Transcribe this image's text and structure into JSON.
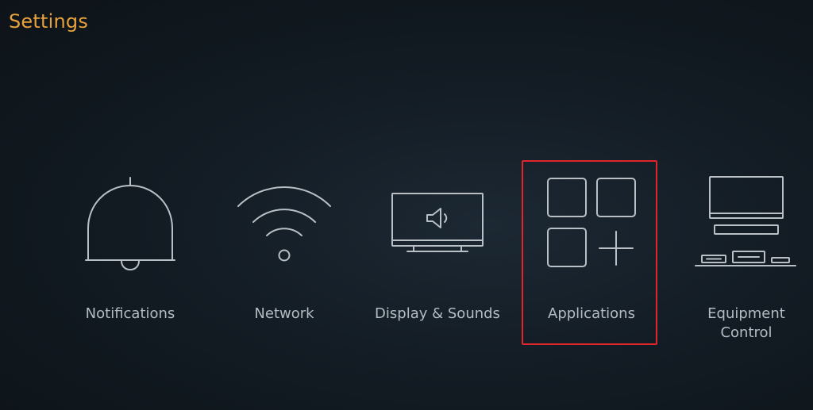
{
  "header": {
    "title": "Settings"
  },
  "menu": {
    "items": [
      {
        "id": "notifications",
        "label": "Notifications",
        "icon": "bell-icon"
      },
      {
        "id": "network",
        "label": "Network",
        "icon": "wifi-icon"
      },
      {
        "id": "display-sounds",
        "label": "Display & Sounds",
        "icon": "tv-speaker-icon"
      },
      {
        "id": "applications",
        "label": "Applications",
        "icon": "apps-grid-icon",
        "focused": true
      },
      {
        "id": "equipment-control",
        "label_lines": [
          "Equipment",
          "Control"
        ],
        "icon": "equipment-icon"
      }
    ]
  },
  "colors": {
    "title": "#e8a23c",
    "label": "#b3bcc3",
    "icon_stroke": "#b8c0c6",
    "focus_border": "#e0262b",
    "background": "#131c24"
  }
}
